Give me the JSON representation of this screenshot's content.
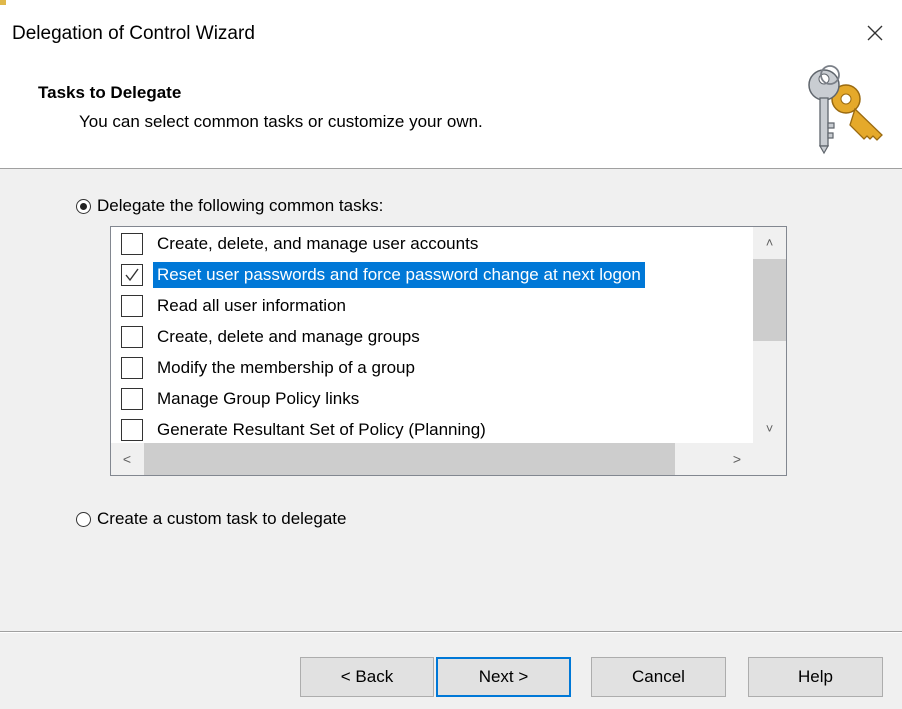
{
  "window": {
    "title": "Delegation of Control Wizard",
    "close_glyph": "✕"
  },
  "header": {
    "title": "Tasks to Delegate",
    "subtitle": "You can select common tasks or customize your own.",
    "icon": "keys-icon"
  },
  "options": {
    "common": {
      "label": "Delegate the following common tasks:",
      "selected": true
    },
    "custom": {
      "label": "Create a custom task to delegate",
      "selected": false
    }
  },
  "tasks": [
    {
      "label": "Create, delete, and manage user accounts",
      "checked": false,
      "selected": false
    },
    {
      "label": "Reset user passwords and force password change at next logon",
      "checked": true,
      "selected": true
    },
    {
      "label": "Read all user information",
      "checked": false,
      "selected": false
    },
    {
      "label": "Create, delete and manage groups",
      "checked": false,
      "selected": false
    },
    {
      "label": "Modify the membership of a group",
      "checked": false,
      "selected": false
    },
    {
      "label": "Manage Group Policy links",
      "checked": false,
      "selected": false
    },
    {
      "label": "Generate Resultant Set of Policy (Planning)",
      "checked": false,
      "selected": false
    }
  ],
  "scrollbars": {
    "up_glyph": "˄",
    "down_glyph": "˅",
    "left_glyph": "<",
    "right_glyph": ">"
  },
  "buttons": {
    "back": "< Back",
    "next": "Next >",
    "cancel": "Cancel",
    "help": "Help"
  },
  "colors": {
    "selection": "#0078d7",
    "default_button_border": "#0078d7",
    "dialog_background": "#f0f0f0"
  }
}
